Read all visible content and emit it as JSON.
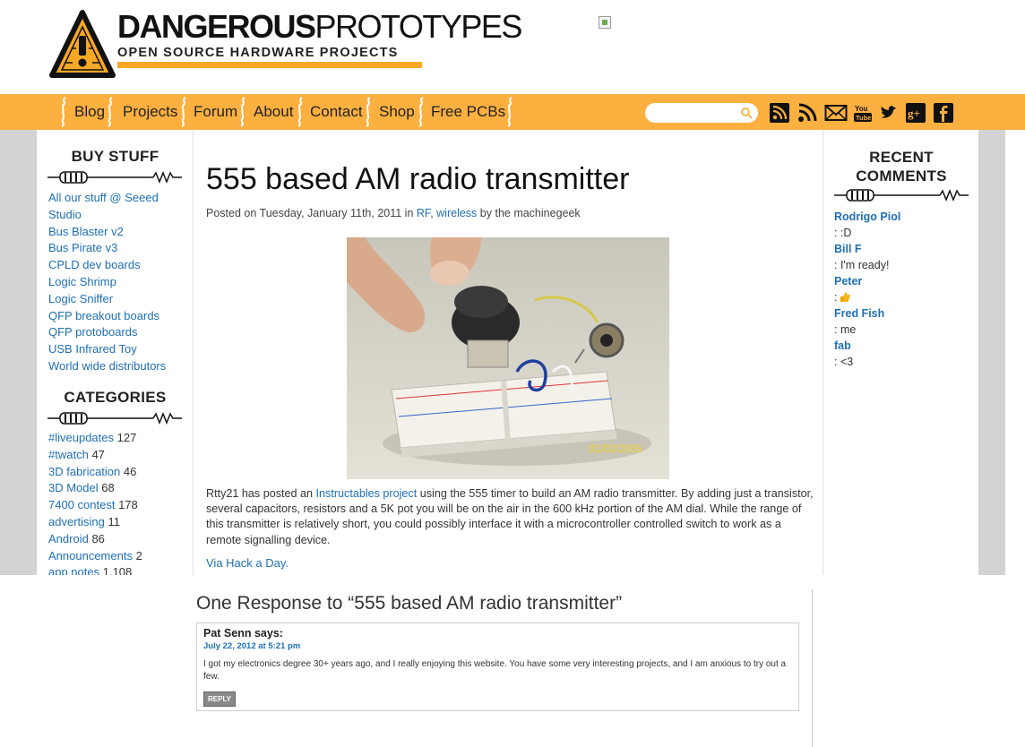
{
  "header": {
    "logo_word_bold": "DANGEROUS",
    "logo_word_thin": "PROTOTYPES",
    "logo_tagline": "OPEN SOURCE HARDWARE PROJECTS"
  },
  "nav": {
    "items": [
      "Blog",
      "Projects",
      "Forum",
      "About",
      "Contact",
      "Shop",
      "Free PCBs"
    ],
    "search_placeholder": "",
    "social_icons": [
      "rss-icon",
      "feed-icon",
      "email-icon",
      "youtube-icon",
      "twitter-icon",
      "googleplus-icon",
      "facebook-icon"
    ]
  },
  "left_sidebar": {
    "buy_heading": "BUY STUFF",
    "buy_items": [
      "All our stuff @ Seeed Studio",
      "Bus Blaster v2",
      "Bus Pirate v3",
      "CPLD dev boards",
      "Logic Shrimp",
      "Logic Sniffer",
      "QFP breakout boards",
      "QFP protoboards",
      "USB Infrared Toy",
      "World wide distributors"
    ],
    "categories_heading": "CATEGORIES",
    "categories": [
      {
        "name": "#liveupdates",
        "count": "127"
      },
      {
        "name": "#twatch",
        "count": "47"
      },
      {
        "name": "3D fabrication",
        "count": "46"
      },
      {
        "name": "3D Model",
        "count": "68"
      },
      {
        "name": "7400 contest",
        "count": "178"
      },
      {
        "name": "advertising",
        "count": "11"
      },
      {
        "name": "Android",
        "count": "86"
      },
      {
        "name": "Announcements",
        "count": "2"
      },
      {
        "name": "app notes",
        "count": "1,108"
      }
    ]
  },
  "post": {
    "title": "555 based AM radio transmitter",
    "meta_prefix": "Posted on Tuesday, January 11th, 2011 in",
    "category_1": "RF",
    "meta_comma": ",",
    "category_2": "wireless",
    "meta_author": "by the machinegeek",
    "photo_date": "01/02/2005",
    "body_before_link": "Rtty21 has posted an",
    "body_link": "Instructables project",
    "body_after_link": "using the 555 timer to build an AM radio transmitter. By adding just a transistor, several capacitors, resistors and a 5K pot you will be on the air in the 600 kHz portion of the AM dial. While the range of this transmitter is relatively short, you could possibly interface it with a microcontroller controlled switch to work as a remote signalling device.",
    "via": "Via Hack a Day."
  },
  "right_sidebar": {
    "heading_line1": "RECENT",
    "heading_line2": "COMMENTS",
    "comments": [
      {
        "author": "Rodrigo Piol",
        "text": ": :D"
      },
      {
        "author": "Bill F",
        "text": ": I'm ready!"
      },
      {
        "author": "Peter",
        "text": ":"
      },
      {
        "author": "Fred Fish",
        "text": ": me"
      },
      {
        "author": "fab",
        "text": ": <3"
      }
    ]
  },
  "responses": {
    "title": "One Response to “555 based AM radio transmitter”",
    "comment_author": "Pat Senn says:",
    "comment_date": "July 22, 2012 at 5:21 pm",
    "comment_text": "I got my electronics degree 30+ years ago, and I really enjoying this website. You have some very interesting projects, and I am anxious to try out a few.",
    "reply_label": "REPLY"
  },
  "colors": {
    "accent": "#fbb040",
    "link": "#1e6fb5",
    "sidebar_gray": "#d3d3d3"
  }
}
